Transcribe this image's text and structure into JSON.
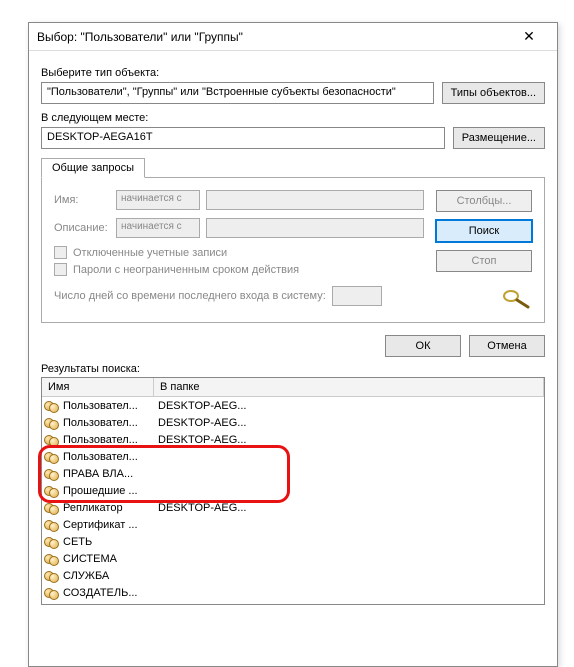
{
  "window": {
    "title": "Выбор: \"Пользователи\" или \"Группы\""
  },
  "objectType": {
    "label": "Выберите тип объекта:",
    "value": "\"Пользователи\", \"Группы\" или \"Встроенные субъекты безопасности\"",
    "button": "Типы объектов..."
  },
  "location": {
    "label": "В следующем месте:",
    "value": "DESKTOP-AEGA16T",
    "button": "Размещение..."
  },
  "tabs": {
    "commonQueries": "Общие запросы"
  },
  "query": {
    "nameLabel": "Имя:",
    "descLabel": "Описание:",
    "startsWith": "начинается с",
    "chkDisabled": "Отключенные учетные записи",
    "chkPwd": "Пароли с неограниченным сроком действия",
    "daysLabel": "Число дней со времени последнего входа в систему:"
  },
  "sideButtons": {
    "columns": "Столбцы...",
    "search": "Поиск",
    "stop": "Стоп"
  },
  "footer": {
    "ok": "ОК",
    "cancel": "Отмена"
  },
  "results": {
    "label": "Результаты поиска:",
    "colName": "Имя",
    "colFolder": "В папке",
    "rows": [
      {
        "name": "Пользовател...",
        "folder": "DESKTOP-AEG..."
      },
      {
        "name": "Пользовател...",
        "folder": "DESKTOP-AEG..."
      },
      {
        "name": "Пользовател...",
        "folder": "DESKTOP-AEG..."
      },
      {
        "name": "Пользовател...",
        "folder": ""
      },
      {
        "name": "ПРАВА ВЛА...",
        "folder": ""
      },
      {
        "name": "Прошедшие ...",
        "folder": ""
      },
      {
        "name": "Репликатор",
        "folder": "DESKTOP-AEG..."
      },
      {
        "name": "Сертификат ...",
        "folder": ""
      },
      {
        "name": "СЕТЬ",
        "folder": ""
      },
      {
        "name": "СИСТЕМА",
        "folder": ""
      },
      {
        "name": "СЛУЖБА",
        "folder": ""
      },
      {
        "name": "СОЗДАТЕЛЬ...",
        "folder": ""
      }
    ]
  }
}
